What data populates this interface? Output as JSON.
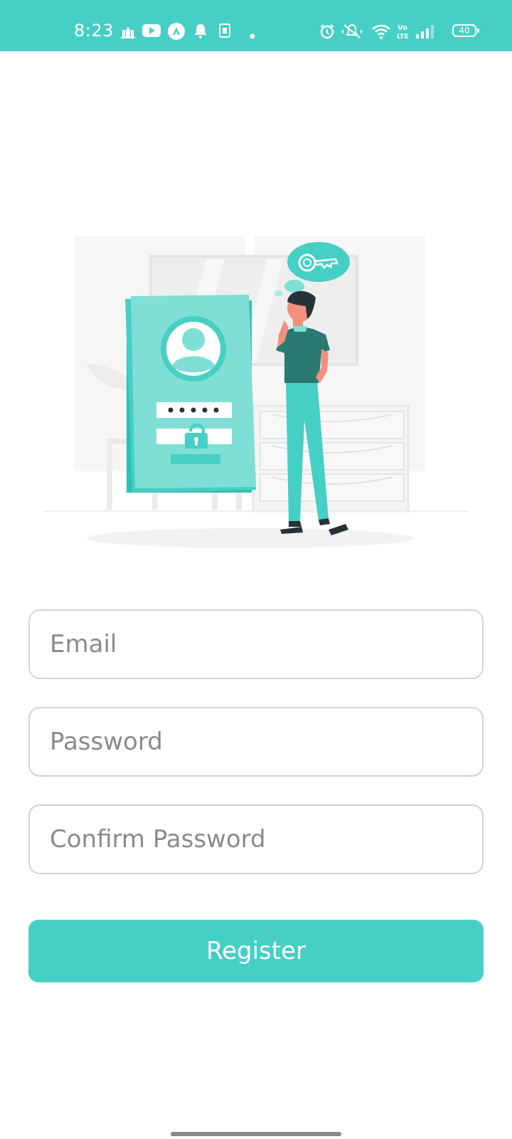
{
  "status_bar": {
    "time": "8:23",
    "battery_level": "40",
    "background_color": "#46cfc4",
    "left_icons": [
      "mosque-icon",
      "youtube-icon",
      "app-a-icon",
      "notification-bell-icon",
      "sim-card-icon",
      "dot-icon"
    ],
    "right_icons": [
      "alarm-icon",
      "vibrate-off-icon",
      "wifi-icon",
      "volte-icon",
      "signal-icon",
      "battery-icon"
    ]
  },
  "illustration": {
    "description_icon": "login-security-illustration"
  },
  "form": {
    "email_placeholder": "Email",
    "password_placeholder": "Password",
    "confirm_password_placeholder": "Confirm Password",
    "email_value": "",
    "password_value": "",
    "confirm_password_value": "",
    "register_label": "Register"
  },
  "colors": {
    "accent": "#46cfc4",
    "accent_dark": "#2a7a72",
    "field_border": "#cfd3d6",
    "placeholder": "#8a8a8a"
  }
}
